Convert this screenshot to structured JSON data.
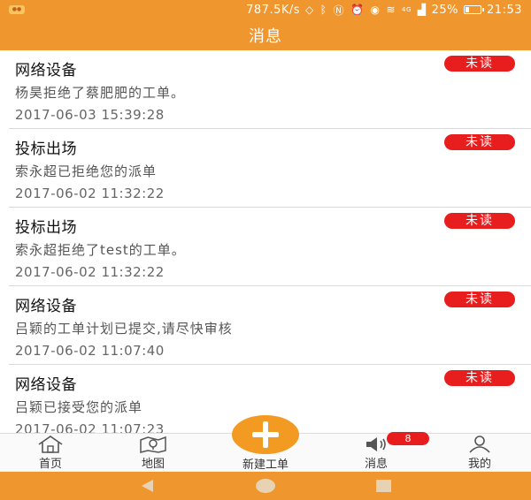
{
  "status_bar": {
    "net_speed": "787.5K/s",
    "battery_percent": "25%",
    "battery_level": 0.25,
    "time": "21:53",
    "signal_label": "4G"
  },
  "header": {
    "title": "消息"
  },
  "messages": [
    {
      "title": "网络设备",
      "content": "杨昊拒绝了蔡肥肥的工单。",
      "time": "2017-06-03 15:39:28",
      "badge": "未读"
    },
    {
      "title": "投标出场",
      "content": "索永超已拒绝您的派单",
      "time": "2017-06-02 11:32:22",
      "badge": "未读"
    },
    {
      "title": "投标出场",
      "content": "索永超拒绝了test的工单。",
      "time": "2017-06-02 11:32:22",
      "badge": "未读"
    },
    {
      "title": "网络设备",
      "content": "吕颖的工单计划已提交,请尽快审核",
      "time": "2017-06-02 11:07:40",
      "badge": "未读"
    },
    {
      "title": "网络设备",
      "content": "吕颖已接受您的派单",
      "time": "2017-06-02 11:07:23",
      "badge": "未读"
    }
  ],
  "tabbar": {
    "home": "首页",
    "map": "地图",
    "new_order": "新建工单",
    "messages": "消息",
    "messages_badge": "8",
    "mine": "我的"
  },
  "colors": {
    "accent": "#f0962f",
    "unread": "#e81d1d"
  }
}
